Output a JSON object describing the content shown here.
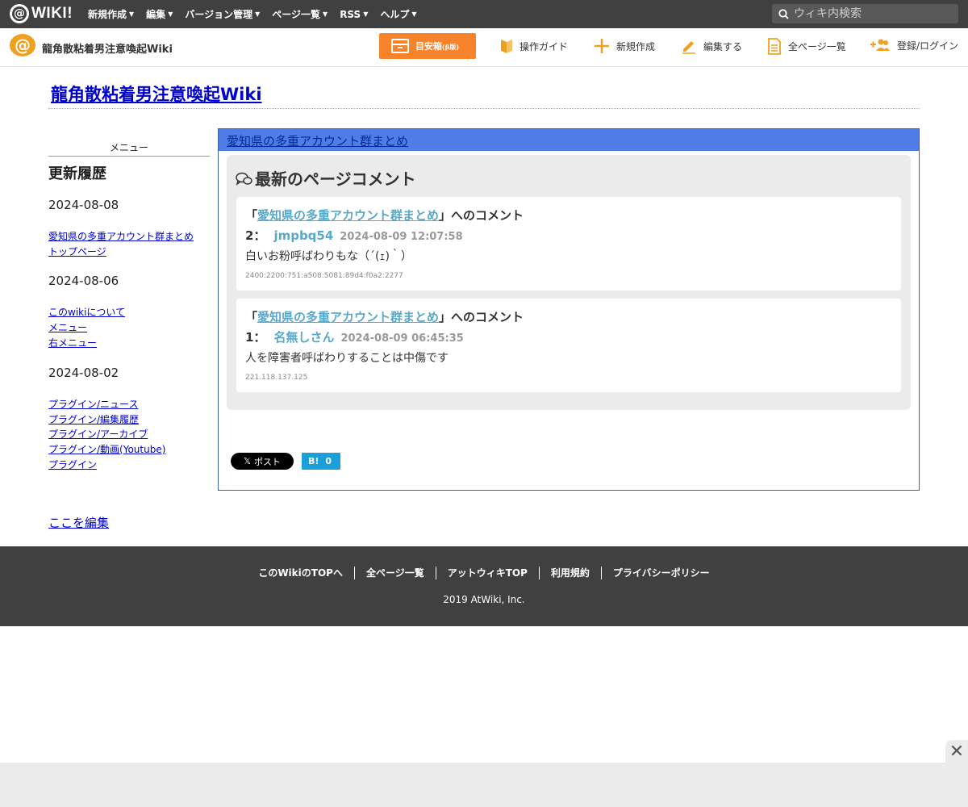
{
  "brand": {
    "logo_at": "@",
    "logo_text": "WIKI!"
  },
  "top_menu": [
    {
      "label": "新規作成"
    },
    {
      "label": "編集"
    },
    {
      "label": "バージョン管理"
    },
    {
      "label": "ページ一覧"
    },
    {
      "label": "RSS"
    },
    {
      "label": "ヘルプ"
    }
  ],
  "search": {
    "placeholder": "ウィキ内検索"
  },
  "site": {
    "logo_at": "@",
    "name": "龍角散粘着男注意喚起Wiki"
  },
  "guide_button": {
    "label": "目安箱",
    "suffix": "(β版)"
  },
  "nav": {
    "guide": "操作ガイド",
    "new": "新規作成",
    "edit": "編集する",
    "all_pages": "全ページ一覧",
    "login": "登録/ログイン"
  },
  "wiki_title": "龍角散粘着男注意喚起Wiki",
  "sidebar": {
    "menu_heading": "メニュー",
    "history_heading": "更新履歴",
    "groups": [
      {
        "date": "2024-08-08",
        "links": [
          "愛知県の多重アカウント群まとめ",
          "トップページ"
        ]
      },
      {
        "date": "2024-08-06",
        "links": [
          "このwikiについて",
          "メニュー",
          "右メニュー"
        ]
      },
      {
        "date": "2024-08-02",
        "links": [
          "プラグイン/ニュース",
          "プラグイン/編集履歴",
          "プラグイン/アーカイブ",
          "プラグイン/動画(Youtube)",
          "プラグイン"
        ]
      }
    ],
    "edit_link": "ここを編集"
  },
  "panel": {
    "page_title": "愛知県の多重アカウント群まとめ",
    "comments_heading": "最新のページコメント",
    "comments": [
      {
        "open_quote": "「",
        "page": "愛知県の多重アカウント群まとめ",
        "suffix": "」へのコメント",
        "num": "2：",
        "author": "jmpbq54",
        "time": "2024-08-09 12:07:58",
        "body": "白いお粉呼ばわりもな（´(ｪ)｀）",
        "ip": "2400:2200:751:a508:5081:89d4:f0a2:2277"
      },
      {
        "open_quote": "「",
        "page": "愛知県の多重アカウント群まとめ",
        "suffix": "」へのコメント",
        "num": "1：",
        "author": "名無しさん",
        "time": "2024-08-09 06:45:35",
        "body": "人を障害者呼ばわりすることは中傷です",
        "ip": "221.118.137.125"
      }
    ],
    "share": {
      "x_label": "ポスト",
      "x_glyph": "𝕏",
      "hatena_label": "B!",
      "hatena_count": "0"
    }
  },
  "footer": {
    "links": [
      "このWikiのTOPへ",
      "全ページ一覧",
      "アットウィキTOP",
      "利用規約",
      "プライバシーポリシー"
    ],
    "copyright": "2019 AtWiki, Inc."
  },
  "ad": {
    "close_glyph": "✕"
  },
  "colors": {
    "accent_orange": "#f7832a",
    "panel_blue": "#4f7ce6",
    "link_teal": "#5aa9c8",
    "dark_bar": "#404040"
  }
}
